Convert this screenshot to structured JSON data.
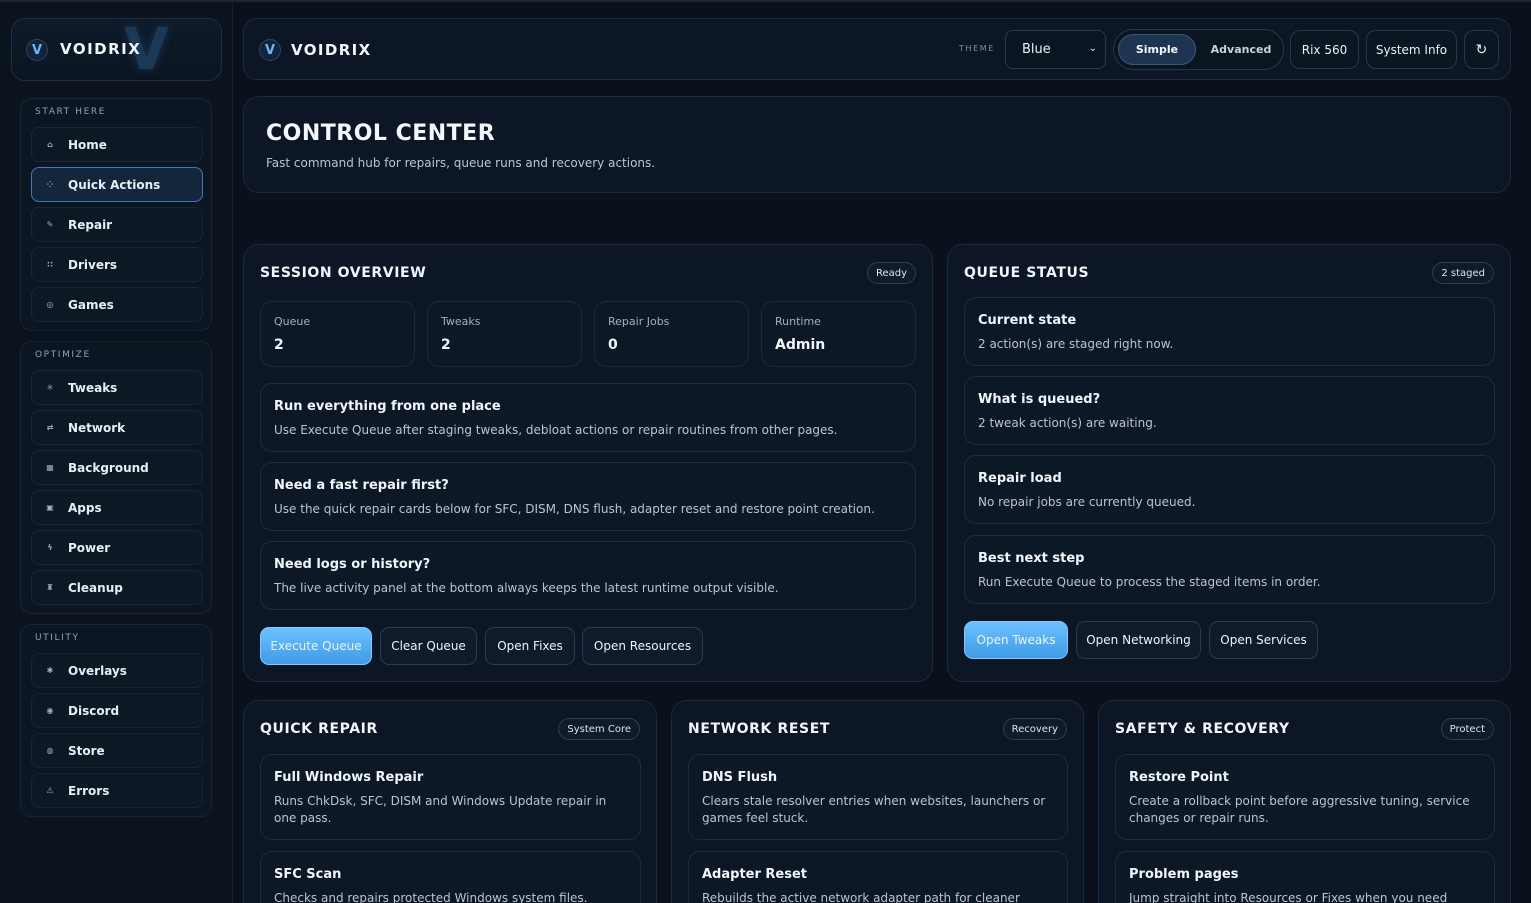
{
  "brand": {
    "name": "VOIDRIX",
    "mark": "V",
    "watermark": "V"
  },
  "sidebar": {
    "groups": [
      {
        "heading": "START HERE",
        "items": [
          {
            "label": "Home",
            "icon": "⌂"
          },
          {
            "label": "Quick Actions",
            "icon": "⁘"
          },
          {
            "label": "Repair",
            "icon": "✎"
          },
          {
            "label": "Drivers",
            "icon": "∷"
          },
          {
            "label": "Games",
            "icon": "◎"
          }
        ]
      },
      {
        "heading": "OPTIMIZE",
        "items": [
          {
            "label": "Tweaks",
            "icon": "✳"
          },
          {
            "label": "Network",
            "icon": "⇄"
          },
          {
            "label": "Background",
            "icon": "▦"
          },
          {
            "label": "Apps",
            "icon": "▣"
          },
          {
            "label": "Power",
            "icon": "ϟ"
          },
          {
            "label": "Cleanup",
            "icon": "♜"
          }
        ]
      },
      {
        "heading": "UTILITY",
        "items": [
          {
            "label": "Overlays",
            "icon": "✱"
          },
          {
            "label": "Discord",
            "icon": "◉"
          },
          {
            "label": "Store",
            "icon": "◍"
          },
          {
            "label": "Errors",
            "icon": "⚠"
          }
        ]
      }
    ],
    "active": "Quick Actions"
  },
  "topbar": {
    "name": "VOIDRIX",
    "theme_label": "THEME",
    "theme_value": "Blue",
    "mode_simple": "Simple",
    "mode_advanced": "Advanced",
    "mode_selected": "Simple",
    "rix_button": "Rix 560",
    "sysinfo_button": "System Info",
    "refresh_icon": "↻"
  },
  "hero": {
    "title": "CONTROL CENTER",
    "subtitle": "Fast command hub for repairs, queue runs and recovery actions."
  },
  "session": {
    "title": "SESSION OVERVIEW",
    "badge": "Ready",
    "stats": [
      {
        "label": "Queue",
        "value": "2"
      },
      {
        "label": "Tweaks",
        "value": "2"
      },
      {
        "label": "Repair Jobs",
        "value": "0"
      },
      {
        "label": "Runtime",
        "value": "Admin"
      }
    ],
    "cards": [
      {
        "title": "Run everything from one place",
        "desc": "Use Execute Queue after staging tweaks, debloat actions or repair routines from other pages."
      },
      {
        "title": "Need a fast repair first?",
        "desc": "Use the quick repair cards below for SFC, DISM, DNS flush, adapter reset and restore point creation."
      },
      {
        "title": "Need logs or history?",
        "desc": "The live activity panel at the bottom always keeps the latest runtime output visible."
      }
    ],
    "buttons": [
      "Execute Queue",
      "Clear Queue",
      "Open Fixes",
      "Open Resources"
    ]
  },
  "queue": {
    "title": "QUEUE STATUS",
    "badge": "2 staged",
    "cards": [
      {
        "title": "Current state",
        "desc": "2 action(s) are staged right now."
      },
      {
        "title": "What is queued?",
        "desc": "2 tweak action(s) are waiting."
      },
      {
        "title": "Repair load",
        "desc": "No repair jobs are currently queued."
      },
      {
        "title": "Best next step",
        "desc": "Run Execute Queue to process the staged items in order."
      }
    ],
    "buttons": [
      "Open Tweaks",
      "Open Networking",
      "Open Services"
    ]
  },
  "quick_repair": {
    "title": "QUICK REPAIR",
    "badge": "System Core",
    "cards": [
      {
        "title": "Full Windows Repair",
        "desc": "Runs ChkDsk, SFC, DISM and Windows Update repair in one pass."
      },
      {
        "title": "SFC Scan",
        "desc": "Checks and repairs protected Windows system files."
      }
    ]
  },
  "network_reset": {
    "title": "NETWORK RESET",
    "badge": "Recovery",
    "cards": [
      {
        "title": "DNS Flush",
        "desc": "Clears stale resolver entries when websites, launchers or games feel stuck."
      },
      {
        "title": "Adapter Reset",
        "desc": "Rebuilds the active network adapter path for cleaner"
      }
    ]
  },
  "safety": {
    "title": "SAFETY & RECOVERY",
    "badge": "Protect",
    "cards": [
      {
        "title": "Restore Point",
        "desc": "Create a rollback point before aggressive tuning, service changes or repair runs."
      },
      {
        "title": "Problem pages",
        "desc": "Jump straight into Resources or Fixes when you need driver,"
      }
    ]
  },
  "colors": {
    "background": "#0a111c",
    "accent": "#4fa8ef",
    "panel": "#0c1624"
  }
}
